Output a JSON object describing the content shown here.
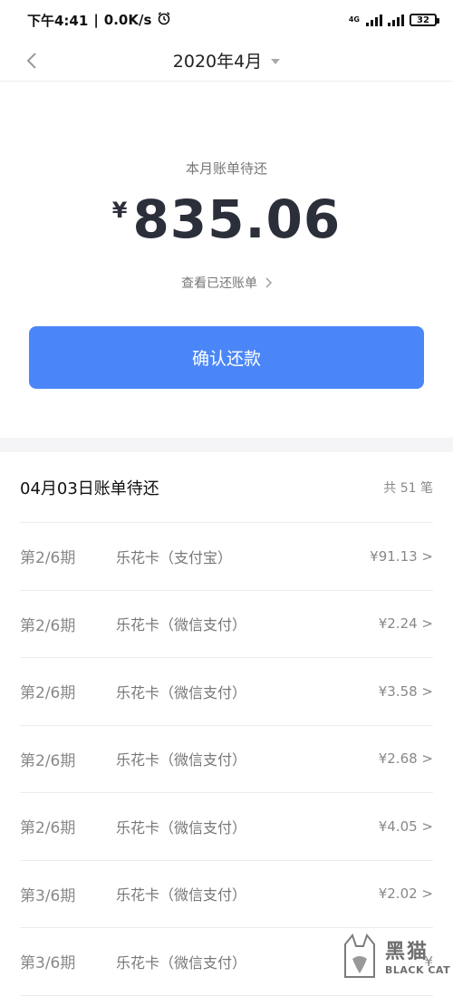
{
  "status_bar": {
    "time": "下午4:41",
    "speed": "0.0K/s",
    "network": "4G",
    "battery": "32",
    "icons": [
      "alarm-icon",
      "signal-icon",
      "battery-icon"
    ]
  },
  "nav": {
    "title": "2020年4月",
    "back_icon": "chevron-left-icon",
    "dropdown_icon": "caret-down-icon"
  },
  "summary": {
    "label": "本月账单待还",
    "currency": "¥",
    "amount": "835.06",
    "history_link": "查看已还账单",
    "confirm_button": "确认还款"
  },
  "bills": {
    "title": "04月03日账单待还",
    "count": "共 51 笔",
    "rows": [
      {
        "period": "第2/6期",
        "desc": "乐花卡（支付宝）",
        "amount": "¥91.13 >"
      },
      {
        "period": "第2/6期",
        "desc": "乐花卡（微信支付）",
        "amount": "¥2.24 >"
      },
      {
        "period": "第2/6期",
        "desc": "乐花卡（微信支付）",
        "amount": "¥3.58 >"
      },
      {
        "period": "第2/6期",
        "desc": "乐花卡（微信支付）",
        "amount": "¥2.68 >"
      },
      {
        "period": "第2/6期",
        "desc": "乐花卡（微信支付）",
        "amount": "¥4.05 >"
      },
      {
        "period": "第3/6期",
        "desc": "乐花卡（微信支付）",
        "amount": "¥2.02 >"
      },
      {
        "period": "第3/6期",
        "desc": "乐花卡（微信支付）",
        "amount": "¥"
      }
    ]
  },
  "watermark": {
    "text_cn": "黑猫",
    "text_en": "BLACK CAT"
  },
  "colors": {
    "primary_button": "#4a86f8",
    "amount_text": "#2b2f3a",
    "divider_strip": "#f5f5f7"
  }
}
